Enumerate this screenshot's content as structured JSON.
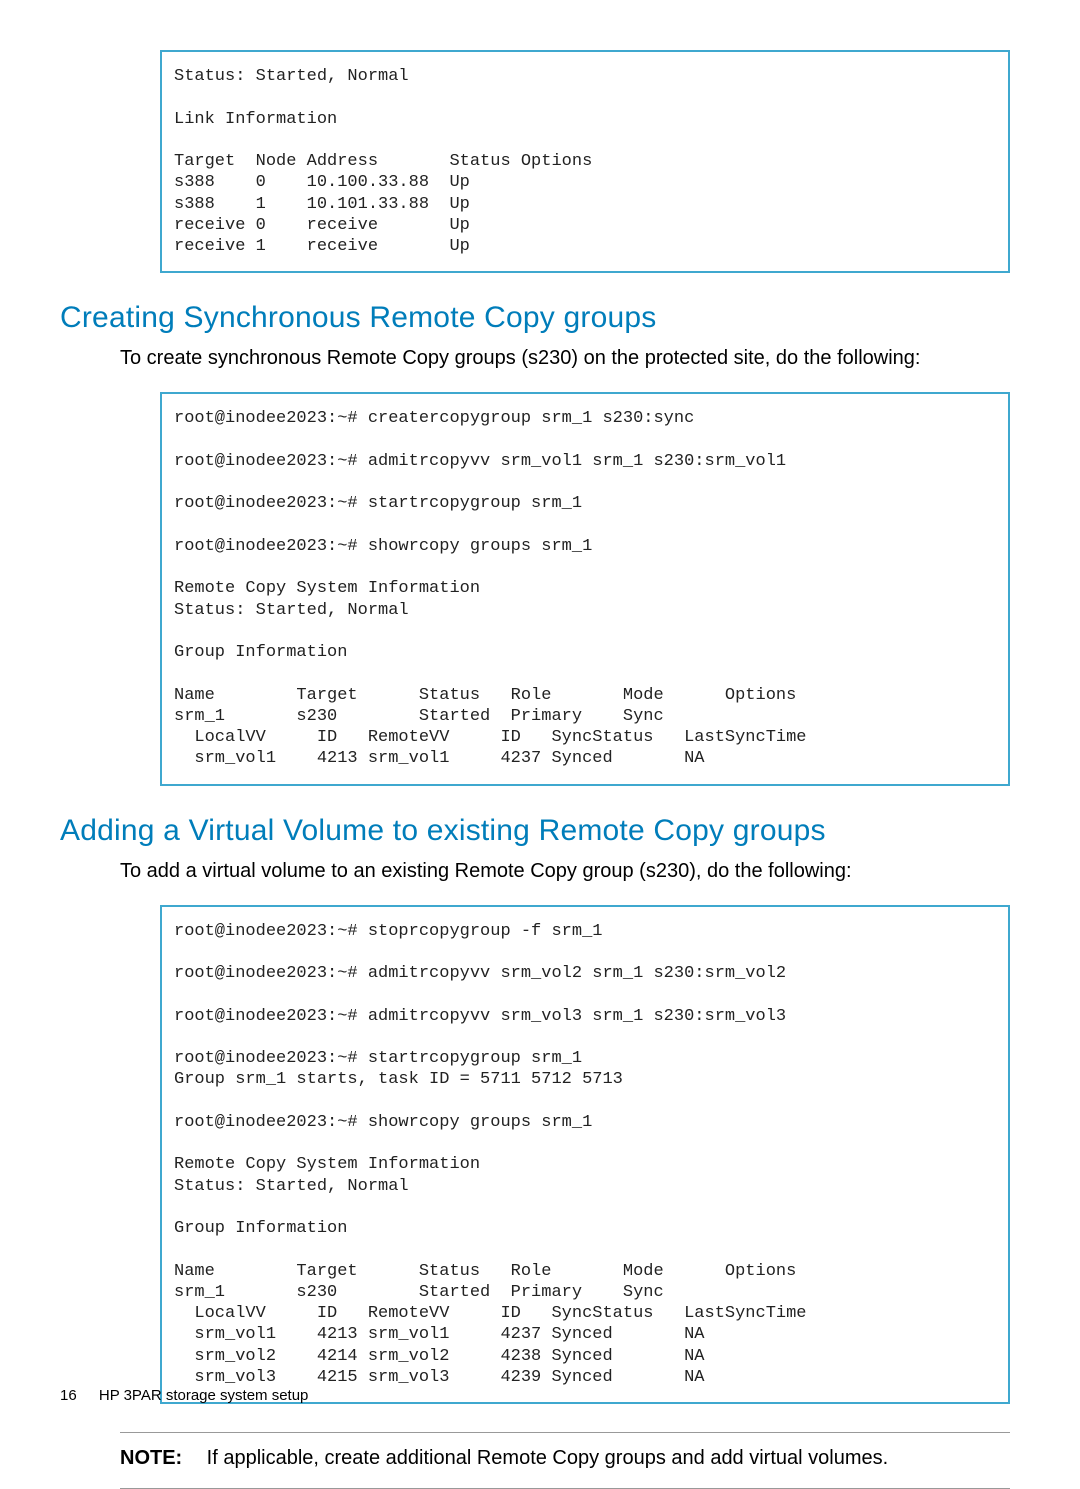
{
  "codebox1": "Status: Started, Normal\n\nLink Information\n\nTarget  Node Address       Status Options\ns388    0    10.100.33.88  Up\ns388    1    10.101.33.88  Up\nreceive 0    receive       Up\nreceive 1    receive       Up",
  "section1": {
    "heading": "Creating Synchronous Remote Copy groups",
    "intro": "To create synchronous Remote Copy groups (s230) on the protected site, do the following:"
  },
  "codebox2": "root@inodee2023:~# creatercopygroup srm_1 s230:sync\n\nroot@inodee2023:~# admitrcopyvv srm_vol1 srm_1 s230:srm_vol1\n\nroot@inodee2023:~# startrcopygroup srm_1\n\nroot@inodee2023:~# showrcopy groups srm_1\n\nRemote Copy System Information\nStatus: Started, Normal\n\nGroup Information\n\nName        Target      Status   Role       Mode      Options\nsrm_1       s230        Started  Primary    Sync\n  LocalVV     ID   RemoteVV     ID   SyncStatus   LastSyncTime\n  srm_vol1    4213 srm_vol1     4237 Synced       NA",
  "section2": {
    "heading": "Adding a Virtual Volume to existing Remote Copy groups",
    "intro": "To add a virtual volume to an existing Remote Copy group (s230), do the following:"
  },
  "codebox3": "root@inodee2023:~# stoprcopygroup -f srm_1\n\nroot@inodee2023:~# admitrcopyvv srm_vol2 srm_1 s230:srm_vol2\n\nroot@inodee2023:~# admitrcopyvv srm_vol3 srm_1 s230:srm_vol3\n\nroot@inodee2023:~# startrcopygroup srm_1\nGroup srm_1 starts, task ID = 5711 5712 5713\n\nroot@inodee2023:~# showrcopy groups srm_1\n\nRemote Copy System Information\nStatus: Started, Normal\n\nGroup Information\n\nName        Target      Status   Role       Mode      Options\nsrm_1       s230        Started  Primary    Sync\n  LocalVV     ID   RemoteVV     ID   SyncStatus   LastSyncTime\n  srm_vol1    4213 srm_vol1     4237 Synced       NA\n  srm_vol2    4214 srm_vol2     4238 Synced       NA\n  srm_vol3    4215 srm_vol3     4239 Synced       NA",
  "note": {
    "label": "NOTE:",
    "text": "If applicable, create additional Remote Copy groups and add virtual volumes."
  },
  "footer": {
    "page": "16",
    "text": "HP 3PAR storage system setup"
  }
}
